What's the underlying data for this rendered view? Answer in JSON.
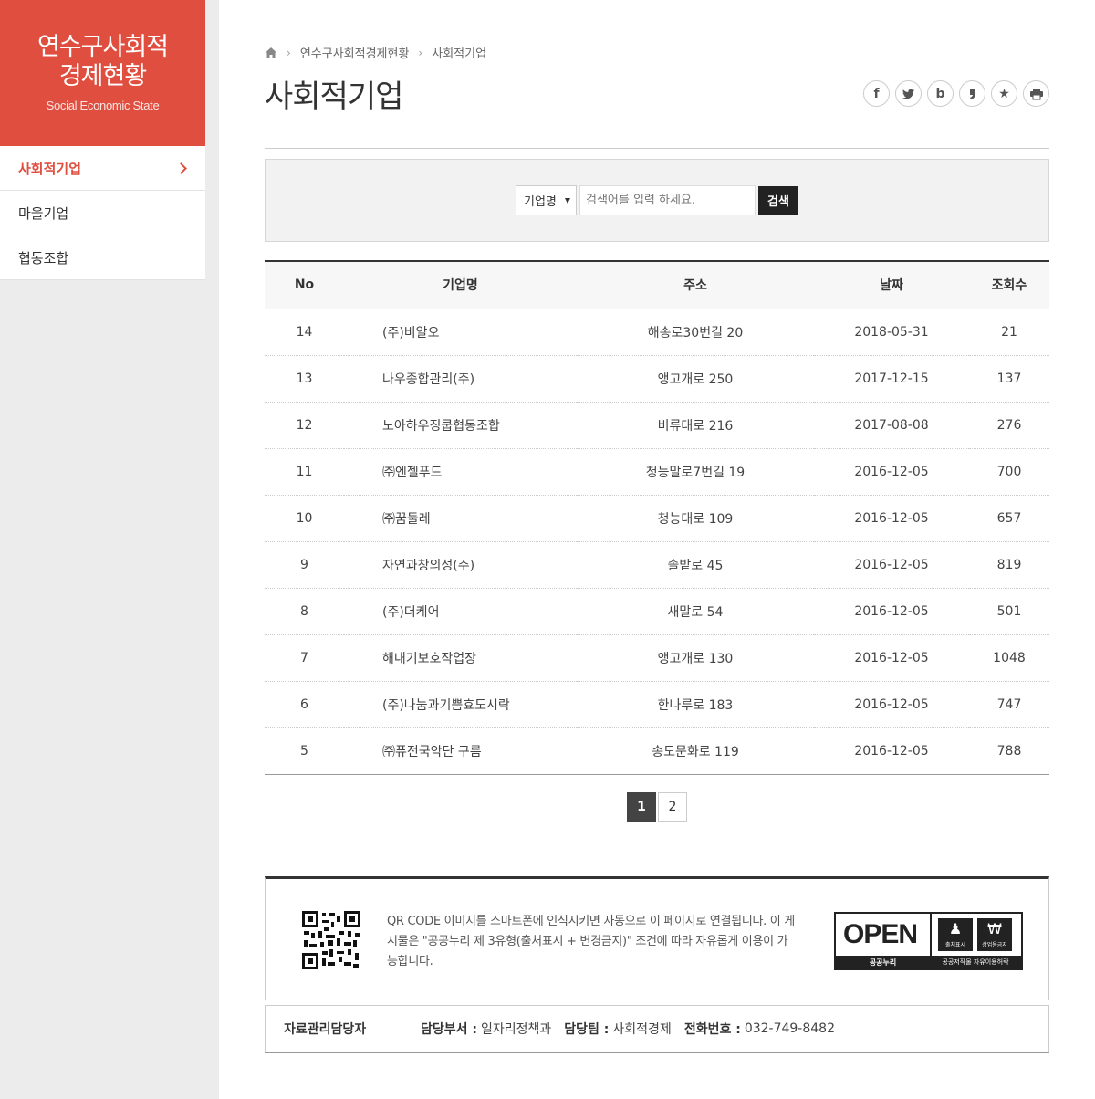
{
  "sidebar": {
    "title": "연수구사회적\n경제현황",
    "subtitle": "Social Economic State",
    "items": [
      {
        "label": "사회적기업"
      },
      {
        "label": "마을기업"
      },
      {
        "label": "협동조합"
      }
    ]
  },
  "breadcrumb": {
    "items": [
      "연수구사회적경제현황",
      "사회적기업"
    ]
  },
  "page": {
    "title": "사회적기업"
  },
  "share": {
    "icons": [
      "facebook-icon",
      "twitter-icon",
      "band-icon",
      "kakaostory-icon",
      "favorite-icon",
      "print-icon"
    ]
  },
  "search": {
    "select_value": "기업명",
    "placeholder": "검색어를 입력 하세요.",
    "button_label": "검색"
  },
  "table": {
    "headers": [
      "No",
      "기업명",
      "주소",
      "날짜",
      "조회수"
    ],
    "rows": [
      [
        "14",
        "(주)비알오",
        "해송로30번길 20",
        "2018-05-31",
        "21"
      ],
      [
        "13",
        "나우종합관리(주)",
        "앵고개로 250",
        "2017-12-15",
        "137"
      ],
      [
        "12",
        "노아하우징쿱협동조합",
        "비류대로 216",
        "2017-08-08",
        "276"
      ],
      [
        "11",
        "㈜엔젤푸드",
        "청능말로7번길 19",
        "2016-12-05",
        "700"
      ],
      [
        "10",
        "㈜꿈둘레",
        "청능대로 109",
        "2016-12-05",
        "657"
      ],
      [
        "9",
        "자연과창의성(주)",
        "솔밭로 45",
        "2016-12-05",
        "819"
      ],
      [
        "8",
        "(주)더케어",
        "새말로 54",
        "2016-12-05",
        "501"
      ],
      [
        "7",
        "해내기보호작업장",
        "앵고개로 130",
        "2016-12-05",
        "1048"
      ],
      [
        "6",
        "(주)나눔과기쁨효도시락",
        "한나루로 183",
        "2016-12-05",
        "747"
      ],
      [
        "5",
        "㈜퓨전국악단 구름",
        "송도문화로 119",
        "2016-12-05",
        "788"
      ]
    ]
  },
  "pagination": {
    "pages": [
      "1",
      "2"
    ],
    "current": "1"
  },
  "footer": {
    "qr_text": "QR CODE 이미지를 스마트폰에 인식시키면 자동으로 이 페이지로 연결됩니다. 이 게시물은 \"공공누리 제 3유형(출처표시 + 변경금지)\" 조건에 따라 자유롭게 이용이 가능합니다.",
    "badge": {
      "word": "OPEN",
      "icon1_label": "출처표시",
      "icon2_label": "상업용금지",
      "bar_left": "공공누리",
      "bar_right": "공공저작물 자유이용허락"
    },
    "contact": {
      "label": "자료관리담당자",
      "dept_key": "담당부서 :",
      "dept_val": "일자리정책과",
      "team_key": "담당팀 :",
      "team_val": "사회적경제",
      "phone_key": "전화번호 :",
      "phone_val": "032-749-8482"
    }
  },
  "colors": {
    "accent": "#e04e40",
    "dark": "#333333",
    "sidebar_bg": "#ececec"
  }
}
